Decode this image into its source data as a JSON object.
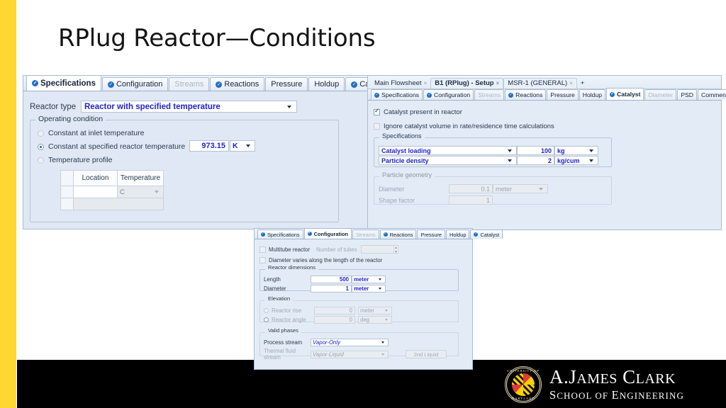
{
  "slide": {
    "title": "RPlug Reactor—Conditions",
    "accent_yellow": "#FFD632",
    "footer_black": "#000000",
    "field_blue": "#2222CC"
  },
  "panel_specifications": {
    "tabs": [
      {
        "label": "Specifications",
        "icon": "blue-check-icon",
        "state": "active"
      },
      {
        "label": "Configuration",
        "icon": "blue-check-icon",
        "state": "normal"
      },
      {
        "label": "Streams",
        "icon": "none",
        "state": "disabled"
      },
      {
        "label": "Reactions",
        "icon": "blue-check-icon",
        "state": "normal"
      },
      {
        "label": "Pressure",
        "icon": "none",
        "state": "normal"
      },
      {
        "label": "Holdup",
        "icon": "none",
        "state": "normal"
      },
      {
        "label": "Catalyst",
        "icon": "blue-check-icon",
        "state": "normal"
      }
    ],
    "reactor_type_label": "Reactor type",
    "reactor_type_value": "Reactor with specified temperature",
    "operating_condition_legend": "Operating condition",
    "option_inlet": "Constant at inlet temperature",
    "option_specified": "Constant at specified reactor temperature",
    "option_profile": "Temperature profile",
    "temperature_value": "973.15",
    "temperature_units": "K",
    "table_headers": [
      "Location",
      "Temperature"
    ],
    "table_units_cell": "C"
  },
  "panel_catalyst": {
    "window_tabs": [
      {
        "label": "Main Flowsheet",
        "state": "normal",
        "close": "×"
      },
      {
        "label": "B1 (RPlug) - Setup",
        "state": "selected",
        "close": "×"
      },
      {
        "label": "MSR-1 (GENERAL)",
        "state": "normal",
        "close": "×"
      }
    ],
    "new_tab_label": "+",
    "tabs": [
      {
        "label": "Specifications",
        "icon": "blue-check-icon",
        "state": "normal"
      },
      {
        "label": "Configuration",
        "icon": "blue-check-icon",
        "state": "normal"
      },
      {
        "label": "Streams",
        "icon": "none",
        "state": "disabled"
      },
      {
        "label": "Reactions",
        "icon": "blue-check-icon",
        "state": "normal"
      },
      {
        "label": "Pressure",
        "icon": "none",
        "state": "normal"
      },
      {
        "label": "Holdup",
        "icon": "none",
        "state": "normal"
      },
      {
        "label": "Catalyst",
        "icon": "blue-check-icon",
        "state": "active"
      },
      {
        "label": "Diameter",
        "icon": "none",
        "state": "disabled"
      },
      {
        "label": "PSD",
        "icon": "none",
        "state": "normal"
      },
      {
        "label": "Comments",
        "icon": "none",
        "state": "normal"
      }
    ],
    "checkbox_present": {
      "label": "Catalyst present in reactor",
      "checked": true
    },
    "checkbox_ignore": {
      "label": "Ignore catalyst volume in rate/residence time calculations",
      "checked": false
    },
    "specifications_legend": "Specifications",
    "spec_rows": [
      {
        "name": "Catalyst loading",
        "value": "100",
        "units": "kg"
      },
      {
        "name": "Particle density",
        "value": "2",
        "units": "kg/cum"
      }
    ],
    "particle_geometry_legend": "Particle geometry",
    "geometry_rows": [
      {
        "name": "Diameter",
        "value": "0.1",
        "units": "meter"
      },
      {
        "name": "Shape factor",
        "value": "1",
        "units": ""
      }
    ]
  },
  "panel_configuration": {
    "tabs": [
      {
        "label": "Specifications",
        "icon": "blue-check-icon",
        "state": "normal"
      },
      {
        "label": "Configuration",
        "icon": "blue-check-icon",
        "state": "active"
      },
      {
        "label": "Streams",
        "icon": "none",
        "state": "disabled"
      },
      {
        "label": "Reactions",
        "icon": "blue-check-icon",
        "state": "normal"
      },
      {
        "label": "Pressure",
        "icon": "none",
        "state": "normal"
      },
      {
        "label": "Holdup",
        "icon": "none",
        "state": "normal"
      },
      {
        "label": "Catalyst",
        "icon": "blue-check-icon",
        "state": "normal"
      }
    ],
    "checkbox_multitube": {
      "label": "Multitube reactor",
      "checked": false
    },
    "tubes_label": "Number of tubes",
    "tubes_value": "",
    "checkbox_diameter_varies": {
      "label": "Diameter varies along the length of the reactor",
      "checked": false
    },
    "reactor_dimensions_legend": "Reactor dimensions",
    "dimension_rows": [
      {
        "name": "Length",
        "value": "500",
        "units": "meter"
      },
      {
        "name": "Diameter",
        "value": "1",
        "units": "meter"
      }
    ],
    "elevation_legend": "Elevation",
    "elevation_rows": [
      {
        "name": "Reactor rise",
        "value": "0",
        "units": "meter",
        "selected": true
      },
      {
        "name": "Reactor angle",
        "value": "0",
        "units": "deg",
        "selected": false
      }
    ],
    "valid_phases_legend": "Valid phases",
    "process_stream_label": "Process stream",
    "process_stream_value": "Vapor-Only",
    "thermal_fluid_label": "Thermal fluid stream",
    "thermal_fluid_value": "Vapor-Liquid",
    "second_liquid_button": "2nd Liquid"
  },
  "footer": {
    "logo_line1_a": "A.",
    "logo_line1_b": "J",
    "logo_line1_c": "AMES",
    "logo_line1_d": "C",
    "logo_line1_e": "LARK",
    "logo_line2_a": "S",
    "logo_line2_b": "CHOOL OF ",
    "logo_line2_c": "E",
    "logo_line2_d": "NGINEERING",
    "seal_top": "UNIVERSITY OF",
    "seal_bottom": "MARYLAND"
  }
}
